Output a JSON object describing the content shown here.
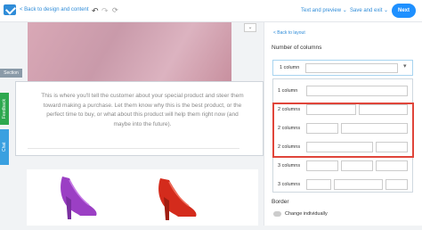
{
  "topbar": {
    "back_label": "< Back to design and content",
    "undo_icon": "↶",
    "redo_icon": "↷",
    "reset_icon": "⟳",
    "text_preview": "Text and preview ⌄",
    "save_exit": "Save and exit ⌄",
    "next_label": "Next"
  },
  "canvas": {
    "collapse_icon": "⌄",
    "section_tag": "Section",
    "paragraph": "This is where you'll tell the customer about your special product and steer them toward making a purchase. Let them know why this is the best product, or the perfect time to buy, or what about this product will help them right now (and maybe into the future).",
    "feedback_tab": "Feedback",
    "chat_tab": "Chat",
    "shoe_colors": [
      "#9b3fc4",
      "#d42b1c"
    ]
  },
  "panel": {
    "back_layout": "< Back to layout",
    "columns_title": "Number of columns",
    "selected_label": "1 column",
    "options": [
      {
        "label": "1 column"
      },
      {
        "label": "2 columns"
      },
      {
        "label": "2 columns"
      },
      {
        "label": "2 columns"
      },
      {
        "label": "3 columns"
      },
      {
        "label": "3 columns"
      }
    ],
    "border_title": "Border",
    "change_individually": "Change individually"
  }
}
